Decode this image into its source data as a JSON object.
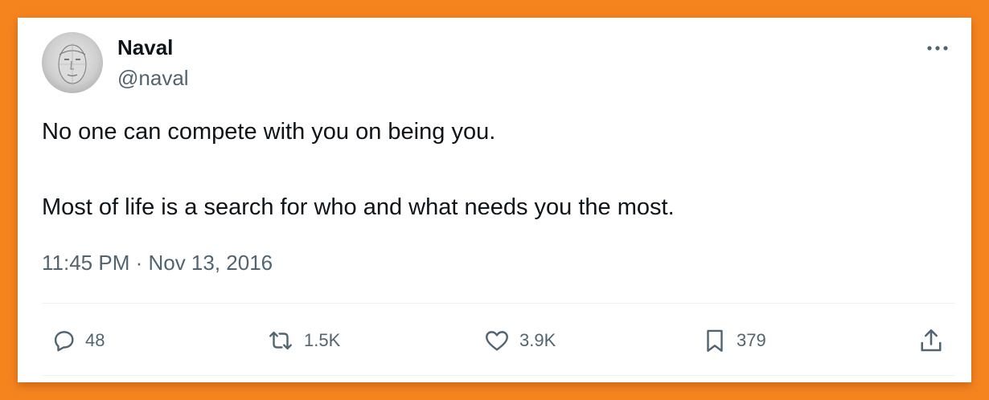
{
  "author": {
    "name": "Naval",
    "handle": "@naval"
  },
  "tweet": {
    "lines": [
      "No one can compete with you on being you.",
      "Most of life is a search for who and what needs you the most."
    ],
    "timestamp": "11:45 PM · Nov 13, 2016"
  },
  "actions": {
    "replies": "48",
    "reposts": "1.5K",
    "likes": "3.9K",
    "bookmarks": "379"
  },
  "icons": {
    "more": "more-dots-icon",
    "reply": "reply-icon",
    "repost": "repost-icon",
    "like": "heart-icon",
    "bookmark": "bookmark-icon",
    "share": "share-icon"
  },
  "colors": {
    "background": "#f5841f",
    "card": "#ffffff",
    "text": "#0f1419",
    "secondary": "#536471"
  }
}
